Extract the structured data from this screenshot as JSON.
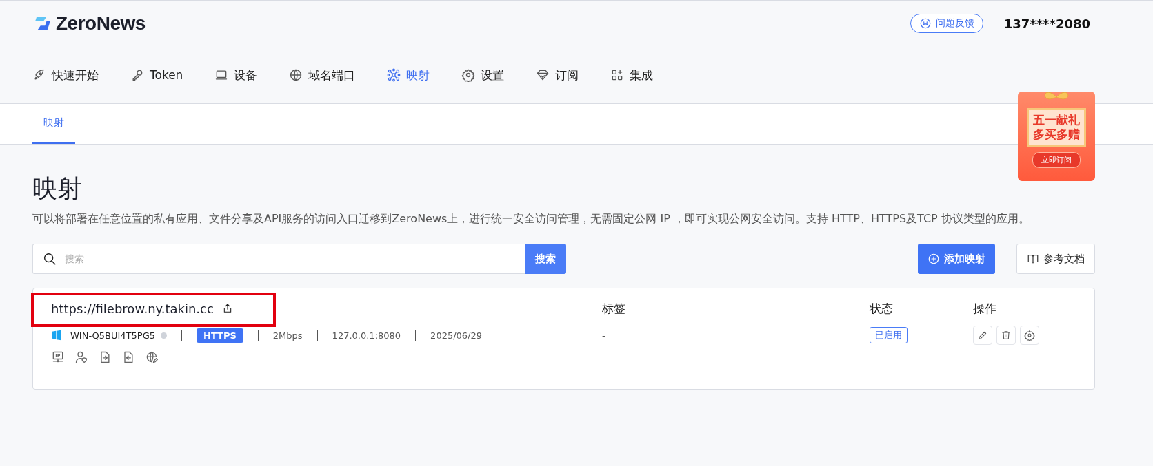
{
  "header": {
    "logo": "ZeroNews",
    "feedback_button": "问题反馈",
    "account": "137****2080"
  },
  "nav": [
    {
      "label": "快速开始",
      "selected": false
    },
    {
      "label": "Token",
      "selected": false
    },
    {
      "label": "设备",
      "selected": false
    },
    {
      "label": "域名端口",
      "selected": false
    },
    {
      "label": "映射",
      "selected": true
    },
    {
      "label": "设置",
      "selected": false
    },
    {
      "label": "订阅",
      "selected": false
    },
    {
      "label": "集成",
      "selected": false
    }
  ],
  "subtabs": [
    {
      "label": "映射",
      "selected": true
    }
  ],
  "promo": {
    "lines": [
      "五一献礼",
      "多买多赠"
    ],
    "button": "立即订阅"
  },
  "page": {
    "title": "映射",
    "description": "可以将部署在任意位置的私有应用、文件分享及API服务的访问入口迁移到ZeroNews上，进行统一安全访问管理，无需固定公网 IP ，即可实现公网安全访问。支持 HTTP、HTTPS及TCP 协议类型的应用。"
  },
  "search": {
    "placeholder": "搜索",
    "button": "搜索"
  },
  "actions": {
    "add": "添加映射",
    "docs": "参考文档"
  },
  "columns": {
    "tags": "标签",
    "status": "状态",
    "operations": "操作"
  },
  "mappings": [
    {
      "url": "https://filebrow.ny.takin.cc",
      "highlighted": true,
      "device": "WIN-Q5BUI4T5PG5",
      "online": false,
      "protocol": "HTTPS",
      "bandwidth": "2Mbps",
      "target": "127.0.0.1:8080",
      "date": "2025/06/29",
      "tags": "-",
      "status": "已启用",
      "enabled": true
    }
  ]
}
